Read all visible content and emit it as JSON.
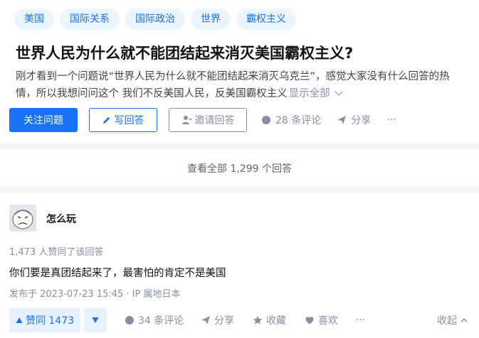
{
  "topics": [
    "美国",
    "国际关系",
    "国际政治",
    "世界",
    "霸权主义"
  ],
  "question": {
    "title": "世界人民为什么就不能团结起来消灭美国霸权主义?",
    "detail_line1": "刚才看到一个问题说“世界人民为什么就不能团结起来消灭乌克兰”，感觉大家没有什么回答的热",
    "detail_line2": "情，所以我想问问这个 我们不反美国人民，反美国霸权主义",
    "show_all": "显示全部"
  },
  "question_actions": {
    "follow": "关注问题",
    "write": "写回答",
    "invite": "邀请回答",
    "comments": "28 条评论",
    "share": "分享",
    "more": "···"
  },
  "view_all": "查看全部 1,299 个回答",
  "answer": {
    "author": "怎么玩",
    "voters": "1,473 人赞同了该回答",
    "text": "你们要是真团结起来了，最害怕的肯定不是美国",
    "published": "发布于 2023-07-23 15:45 · IP 属地日本",
    "upvote": "赞同 1473",
    "comments": "34 条评论",
    "share": "分享",
    "collect": "收藏",
    "like": "喜欢",
    "more": "···",
    "collapse": "收起"
  },
  "colors": {
    "brand": "#1772f6",
    "muted": "#8590a6",
    "tag_bg": "#ebf5ff"
  }
}
